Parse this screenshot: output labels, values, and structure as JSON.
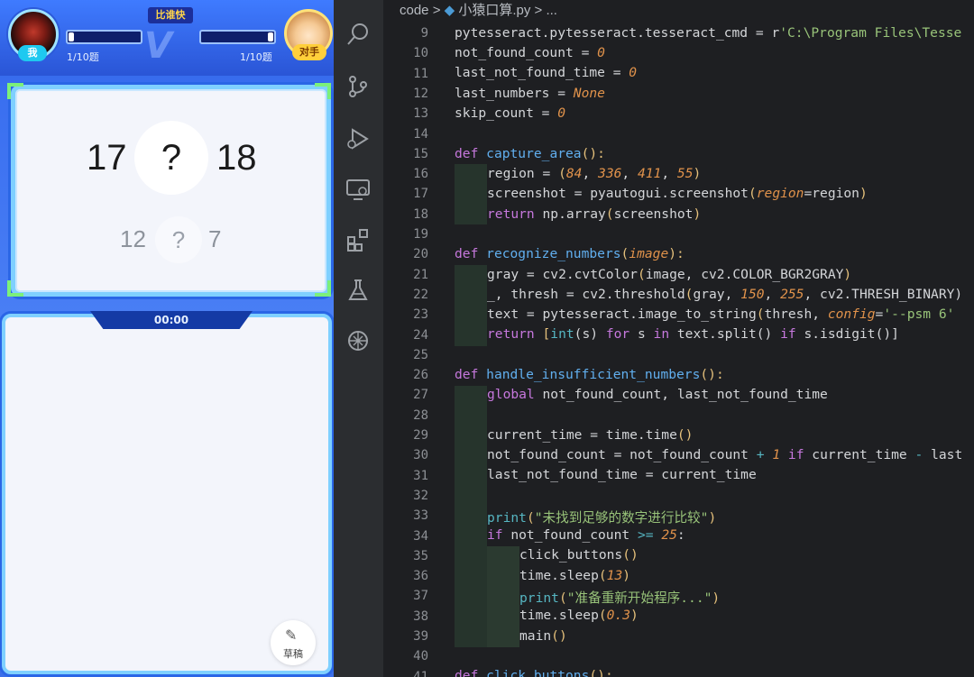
{
  "game": {
    "me_tag": "我",
    "opponent_tag": "对手",
    "title_badge": "比谁快",
    "vs": "V",
    "me_progress": "1/10题",
    "opponent_progress": "1/10题",
    "me_progress_fraction": 0.1,
    "opponent_progress_fraction": 0.1,
    "current": {
      "left": "17",
      "op": "?",
      "right": "18"
    },
    "next": {
      "left": "12",
      "op": "?",
      "right": "7"
    },
    "timer": "00:00",
    "draft_label": "草稿"
  },
  "editor": {
    "breadcrumb": {
      "folder": "code",
      "sep": ">",
      "file": "小猿口算.py",
      "more": "> ..."
    },
    "lines": [
      {
        "n": "9"
      },
      {
        "n": "10"
      },
      {
        "n": "11"
      },
      {
        "n": "12"
      },
      {
        "n": "13"
      },
      {
        "n": "14"
      },
      {
        "n": "15"
      },
      {
        "n": "16"
      },
      {
        "n": "17"
      },
      {
        "n": "18"
      },
      {
        "n": "19"
      },
      {
        "n": "20"
      },
      {
        "n": "21"
      },
      {
        "n": "22"
      },
      {
        "n": "23"
      },
      {
        "n": "24"
      },
      {
        "n": "25"
      },
      {
        "n": "26"
      },
      {
        "n": "27"
      },
      {
        "n": "28"
      },
      {
        "n": "29"
      },
      {
        "n": "30"
      },
      {
        "n": "31"
      },
      {
        "n": "32"
      },
      {
        "n": "33"
      },
      {
        "n": "34"
      },
      {
        "n": "35"
      },
      {
        "n": "36"
      },
      {
        "n": "37"
      },
      {
        "n": "38"
      },
      {
        "n": "39"
      },
      {
        "n": "40"
      },
      {
        "n": "41"
      }
    ],
    "code": {
      "l9_a": "pytesseract.pytesseract.tesseract_cmd = r",
      "l9_b": "'C:\\Program Files\\Tesse",
      "l10_a": "not_found_count = ",
      "l10_b": "0",
      "l11_a": "last_not_found_time = ",
      "l11_b": "0",
      "l12_a": "last_numbers = ",
      "l12_b": "None",
      "l13_a": "skip_count = ",
      "l13_b": "0",
      "l15_def": "def",
      "l15_fn": "capture_area",
      "l15_tail": "():",
      "l16_a": "region = ",
      "l16_b": "(",
      "l16_c": "84",
      "l16_d": ", ",
      "l16_e": "336",
      "l16_f": ", ",
      "l16_g": "411",
      "l16_h": ", ",
      "l16_i": "55",
      "l16_j": ")",
      "l17_a": "screenshot = pyautogui.screenshot",
      "l17_b": "(",
      "l17_c": "region",
      "l17_d": "=region",
      "l17_e": ")",
      "l18_a": "return",
      "l18_b": " np.array",
      "l18_c": "(",
      "l18_d": "screenshot",
      "l18_e": ")",
      "l20_def": "def",
      "l20_fn": "recognize_numbers",
      "l20_b": "(",
      "l20_c": "image",
      "l20_d": "):",
      "l21_a": "gray = cv2.cvtColor",
      "l21_b": "(",
      "l21_c": "image, cv2.COLOR_BGR2GRAY",
      "l21_d": ")",
      "l22_a": "_, thresh = cv2.threshold",
      "l22_b": "(",
      "l22_c": "gray, ",
      "l22_d": "150",
      "l22_e": ", ",
      "l22_f": "255",
      "l22_g": ", cv2.THRESH_BINARY)",
      "l23_a": "text = pytesseract.image_to_string",
      "l23_b": "(",
      "l23_c": "thresh, ",
      "l23_d": "config",
      "l23_e": "=",
      "l23_f": "'--psm 6'",
      "l24_a": "return",
      "l24_b": " [",
      "l24_c": "int",
      "l24_d": "(s) ",
      "l24_e": "for",
      "l24_f": " s ",
      "l24_g": "in",
      "l24_h": " text.split() ",
      "l24_i": "if",
      "l24_j": " s.isdigit()]",
      "l26_def": "def",
      "l26_fn": "handle_insufficient_numbers",
      "l26_tail": "():",
      "l27_a": "global",
      "l27_b": " not_found_count, last_not_found_time",
      "l29_a": "current_time = time.time",
      "l29_b": "()",
      "l30_a": "not_found_count = not_found_count ",
      "l30_b": "+",
      "l30_c": " ",
      "l30_d": "1",
      "l30_e": " ",
      "l30_f": "if",
      "l30_g": " current_time ",
      "l30_h": "-",
      "l30_i": " last",
      "l31_a": "last_not_found_time = current_time",
      "l33_a": "print",
      "l33_b": "(",
      "l33_c": "\"未找到足够的数字进行比较\"",
      "l33_d": ")",
      "l34_a": "if",
      "l34_b": " not_found_count ",
      "l34_c": ">=",
      "l34_d": " ",
      "l34_e": "25",
      "l34_f": ":",
      "l35_a": "click_buttons",
      "l35_b": "()",
      "l36_a": "time.sleep",
      "l36_b": "(",
      "l36_c": "13",
      "l36_d": ")",
      "l37_a": "print",
      "l37_b": "(",
      "l37_c": "\"准备重新开始程序...\"",
      "l37_d": ")",
      "l38_a": "time.sleep",
      "l38_b": "(",
      "l38_c": "0.3",
      "l38_d": ")",
      "l39_a": "main",
      "l39_b": "()",
      "l41_def": "def",
      "l41_fn": "click_buttons",
      "l41_tail": "():"
    }
  },
  "colors": {
    "accent_blue": "#2a66e6",
    "keyword": "#c678dd",
    "function": "#61afef",
    "number": "#e0924b",
    "string": "#98c379"
  }
}
